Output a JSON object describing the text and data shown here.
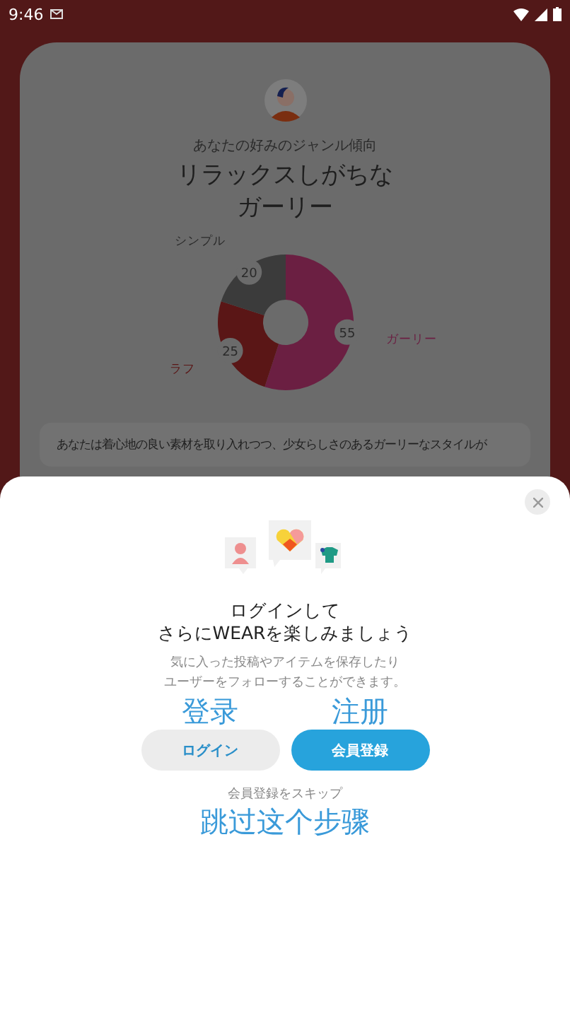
{
  "status_bar": {
    "time": "9:46"
  },
  "result_card": {
    "subtitle": "あなたの好みのジャンル傾向",
    "title": [
      "リラックスしがちな",
      "ガーリー"
    ],
    "chart_data": {
      "type": "donut",
      "categories": [
        "ガーリー",
        "ラフ",
        "シンプル"
      ],
      "values": [
        55,
        25,
        20
      ],
      "colors": [
        "#6b1f42",
        "#5a1616",
        "#3b3b3b"
      ],
      "data_labels": true
    },
    "description": "あなたは着心地の良い素材を取り入れつつ、少女らしさのあるガーリーなスタイルが"
  },
  "login_sheet": {
    "title": [
      "ログインして",
      "さらにWEARを楽しみましょう"
    ],
    "description": [
      "気に入った投稿やアイテムを保存したり",
      "ユーザーをフォローすることができます。"
    ],
    "buttons": [
      {
        "label": "ログイン",
        "kind": "secondary",
        "annotation": "登录"
      },
      {
        "label": "会員登録",
        "kind": "primary",
        "annotation": "注册"
      }
    ],
    "skip_link": "会員登録をスキップ",
    "skip_annotation": "跳过这个步骤"
  }
}
